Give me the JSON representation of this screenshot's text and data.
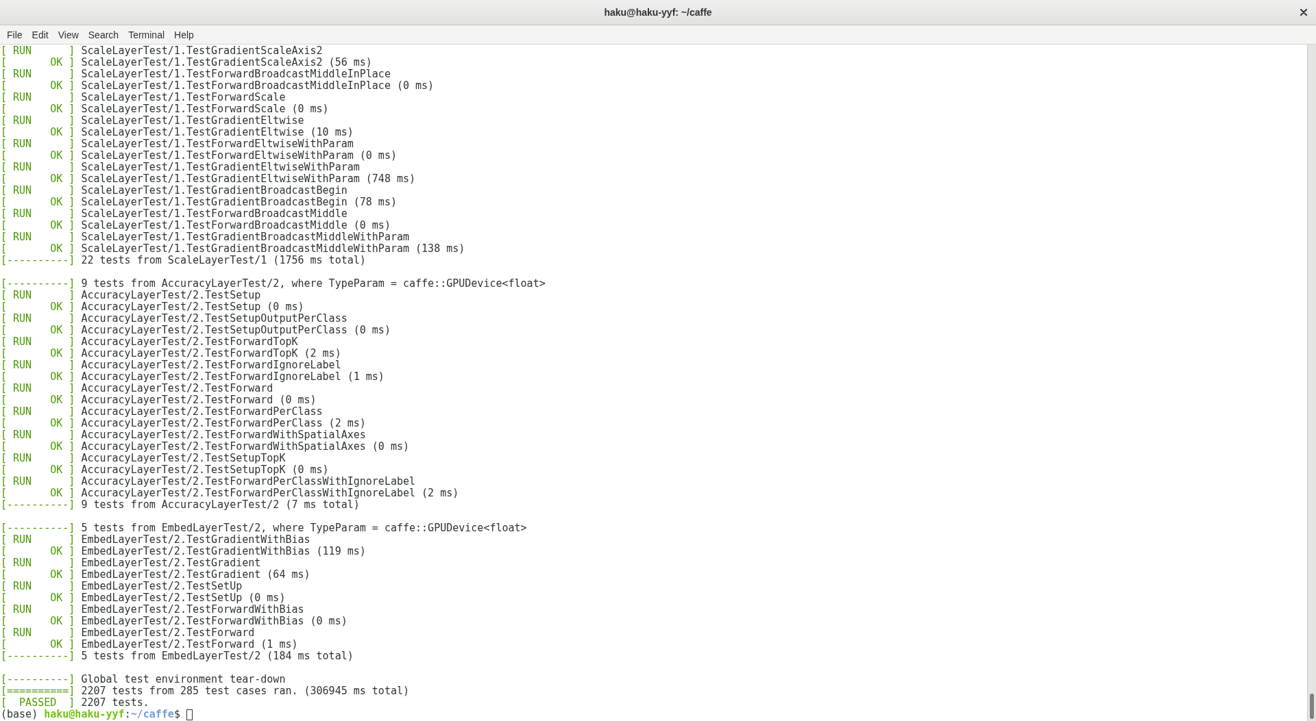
{
  "window": {
    "title": "haku@haku-yyf: ~/caffe"
  },
  "menu": [
    "File",
    "Edit",
    "View",
    "Search",
    "Terminal",
    "Help"
  ],
  "terminal": {
    "blocks": [
      {
        "lines": [
          {
            "tag": "[ RUN      ]",
            "text": "ScaleLayerTest/1.TestGradientScaleAxis2"
          },
          {
            "tag": "[       OK ]",
            "text": "ScaleLayerTest/1.TestGradientScaleAxis2 (56 ms)"
          },
          {
            "tag": "[ RUN      ]",
            "text": "ScaleLayerTest/1.TestForwardBroadcastMiddleInPlace"
          },
          {
            "tag": "[       OK ]",
            "text": "ScaleLayerTest/1.TestForwardBroadcastMiddleInPlace (0 ms)"
          },
          {
            "tag": "[ RUN      ]",
            "text": "ScaleLayerTest/1.TestForwardScale"
          },
          {
            "tag": "[       OK ]",
            "text": "ScaleLayerTest/1.TestForwardScale (0 ms)"
          },
          {
            "tag": "[ RUN      ]",
            "text": "ScaleLayerTest/1.TestGradientEltwise"
          },
          {
            "tag": "[       OK ]",
            "text": "ScaleLayerTest/1.TestGradientEltwise (10 ms)"
          },
          {
            "tag": "[ RUN      ]",
            "text": "ScaleLayerTest/1.TestForwardEltwiseWithParam"
          },
          {
            "tag": "[       OK ]",
            "text": "ScaleLayerTest/1.TestForwardEltwiseWithParam (0 ms)"
          },
          {
            "tag": "[ RUN      ]",
            "text": "ScaleLayerTest/1.TestGradientEltwiseWithParam"
          },
          {
            "tag": "[       OK ]",
            "text": "ScaleLayerTest/1.TestGradientEltwiseWithParam (748 ms)"
          },
          {
            "tag": "[ RUN      ]",
            "text": "ScaleLayerTest/1.TestGradientBroadcastBegin"
          },
          {
            "tag": "[       OK ]",
            "text": "ScaleLayerTest/1.TestGradientBroadcastBegin (78 ms)"
          },
          {
            "tag": "[ RUN      ]",
            "text": "ScaleLayerTest/1.TestForwardBroadcastMiddle"
          },
          {
            "tag": "[       OK ]",
            "text": "ScaleLayerTest/1.TestForwardBroadcastMiddle (0 ms)"
          },
          {
            "tag": "[ RUN      ]",
            "text": "ScaleLayerTest/1.TestGradientBroadcastMiddleWithParam"
          },
          {
            "tag": "[       OK ]",
            "text": "ScaleLayerTest/1.TestGradientBroadcastMiddleWithParam (138 ms)"
          },
          {
            "tag": "[----------]",
            "text": "22 tests from ScaleLayerTest/1 (1756 ms total)"
          }
        ]
      },
      {
        "lines": [
          {
            "tag": "[----------]",
            "text": "9 tests from AccuracyLayerTest/2, where TypeParam = caffe::GPUDevice<float>"
          },
          {
            "tag": "[ RUN      ]",
            "text": "AccuracyLayerTest/2.TestSetup"
          },
          {
            "tag": "[       OK ]",
            "text": "AccuracyLayerTest/2.TestSetup (0 ms)"
          },
          {
            "tag": "[ RUN      ]",
            "text": "AccuracyLayerTest/2.TestSetupOutputPerClass"
          },
          {
            "tag": "[       OK ]",
            "text": "AccuracyLayerTest/2.TestSetupOutputPerClass (0 ms)"
          },
          {
            "tag": "[ RUN      ]",
            "text": "AccuracyLayerTest/2.TestForwardTopK"
          },
          {
            "tag": "[       OK ]",
            "text": "AccuracyLayerTest/2.TestForwardTopK (2 ms)"
          },
          {
            "tag": "[ RUN      ]",
            "text": "AccuracyLayerTest/2.TestForwardIgnoreLabel"
          },
          {
            "tag": "[       OK ]",
            "text": "AccuracyLayerTest/2.TestForwardIgnoreLabel (1 ms)"
          },
          {
            "tag": "[ RUN      ]",
            "text": "AccuracyLayerTest/2.TestForward"
          },
          {
            "tag": "[       OK ]",
            "text": "AccuracyLayerTest/2.TestForward (0 ms)"
          },
          {
            "tag": "[ RUN      ]",
            "text": "AccuracyLayerTest/2.TestForwardPerClass"
          },
          {
            "tag": "[       OK ]",
            "text": "AccuracyLayerTest/2.TestForwardPerClass (2 ms)"
          },
          {
            "tag": "[ RUN      ]",
            "text": "AccuracyLayerTest/2.TestForwardWithSpatialAxes"
          },
          {
            "tag": "[       OK ]",
            "text": "AccuracyLayerTest/2.TestForwardWithSpatialAxes (0 ms)"
          },
          {
            "tag": "[ RUN      ]",
            "text": "AccuracyLayerTest/2.TestSetupTopK"
          },
          {
            "tag": "[       OK ]",
            "text": "AccuracyLayerTest/2.TestSetupTopK (0 ms)"
          },
          {
            "tag": "[ RUN      ]",
            "text": "AccuracyLayerTest/2.TestForwardPerClassWithIgnoreLabel"
          },
          {
            "tag": "[       OK ]",
            "text": "AccuracyLayerTest/2.TestForwardPerClassWithIgnoreLabel (2 ms)"
          },
          {
            "tag": "[----------]",
            "text": "9 tests from AccuracyLayerTest/2 (7 ms total)"
          }
        ]
      },
      {
        "lines": [
          {
            "tag": "[----------]",
            "text": "5 tests from EmbedLayerTest/2, where TypeParam = caffe::GPUDevice<float>"
          },
          {
            "tag": "[ RUN      ]",
            "text": "EmbedLayerTest/2.TestGradientWithBias"
          },
          {
            "tag": "[       OK ]",
            "text": "EmbedLayerTest/2.TestGradientWithBias (119 ms)"
          },
          {
            "tag": "[ RUN      ]",
            "text": "EmbedLayerTest/2.TestGradient"
          },
          {
            "tag": "[       OK ]",
            "text": "EmbedLayerTest/2.TestGradient (64 ms)"
          },
          {
            "tag": "[ RUN      ]",
            "text": "EmbedLayerTest/2.TestSetUp"
          },
          {
            "tag": "[       OK ]",
            "text": "EmbedLayerTest/2.TestSetUp (0 ms)"
          },
          {
            "tag": "[ RUN      ]",
            "text": "EmbedLayerTest/2.TestForwardWithBias"
          },
          {
            "tag": "[       OK ]",
            "text": "EmbedLayerTest/2.TestForwardWithBias (0 ms)"
          },
          {
            "tag": "[ RUN      ]",
            "text": "EmbedLayerTest/2.TestForward"
          },
          {
            "tag": "[       OK ]",
            "text": "EmbedLayerTest/2.TestForward (1 ms)"
          },
          {
            "tag": "[----------]",
            "text": "5 tests from EmbedLayerTest/2 (184 ms total)"
          }
        ]
      },
      {
        "lines": [
          {
            "tag": "[----------]",
            "text": "Global test environment tear-down"
          },
          {
            "tag": "[==========]",
            "text": "2207 tests from 285 test cases ran. (306945 ms total)"
          },
          {
            "tag": "[  PASSED  ]",
            "text": "2207 tests."
          }
        ]
      }
    ],
    "prompt": {
      "env": "(base)",
      "user_host": "haku@haku-yyf",
      "separator": ":",
      "path": "~/caffe",
      "symbol": "$"
    }
  }
}
